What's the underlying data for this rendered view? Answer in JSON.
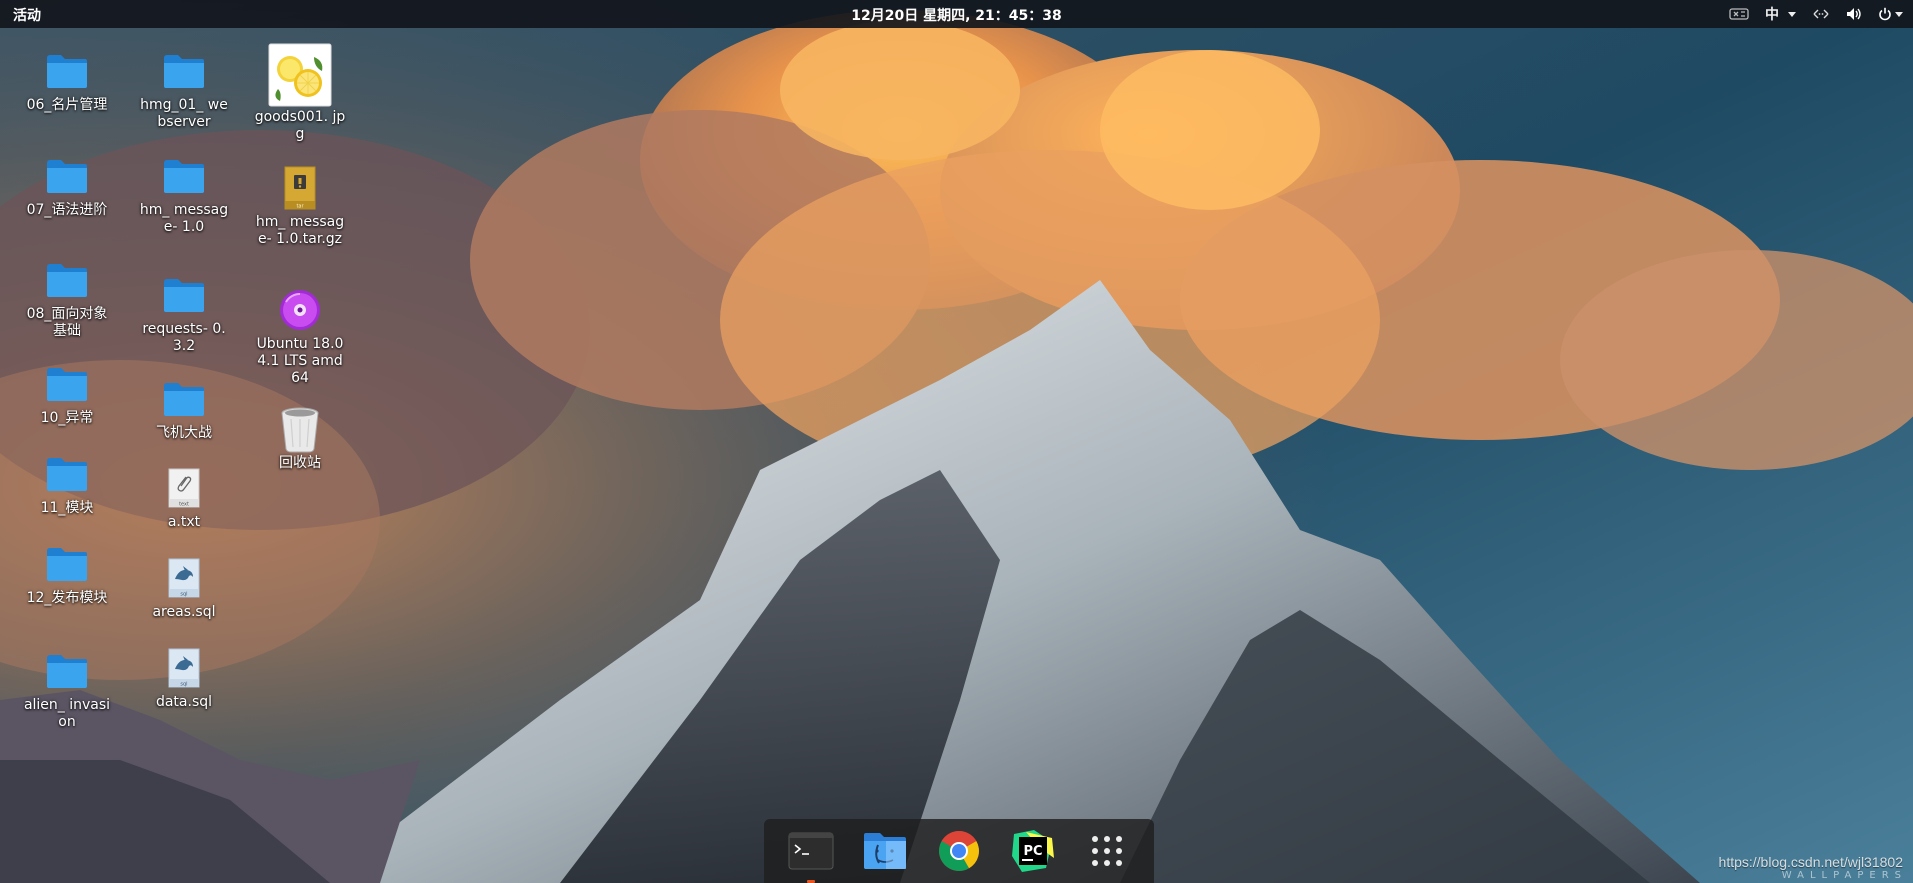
{
  "topbar": {
    "activities": "活动",
    "clock": "12月20日 星期四, 21：45：38",
    "ime": "中"
  },
  "desktop": {
    "col1": [
      "06_名片管理",
      "07_语法进阶",
      "08_面向对象基础",
      "10_异常",
      "11_模块",
      "12_发布模块",
      "alien_ invasion"
    ],
    "col2": [
      "hmg_01_ webserver",
      "hm_ message- 1.0",
      "requests- 0.3.2",
      "飞机大战",
      "a.txt",
      "areas.sql",
      "data.sql"
    ],
    "col3": [
      "goods001. jpg",
      "hm_ message- 1.0.tar.gz",
      "Ubuntu 18.04.1 LTS amd64",
      "回收站"
    ]
  },
  "file_badges": {
    "txt": "text",
    "sql": "sql",
    "tar": "tar"
  },
  "dock": {
    "pycharm_badge": "PC"
  },
  "watermark": "https://blog.csdn.net/wjl31802",
  "wallpaper_brand": "WALLPAPERS",
  "colors": {
    "folder": "#3ba4ef",
    "folder_dark": "#1f7fd1",
    "ubuntu_accent": "#e95420",
    "topbar": "#12161c"
  }
}
